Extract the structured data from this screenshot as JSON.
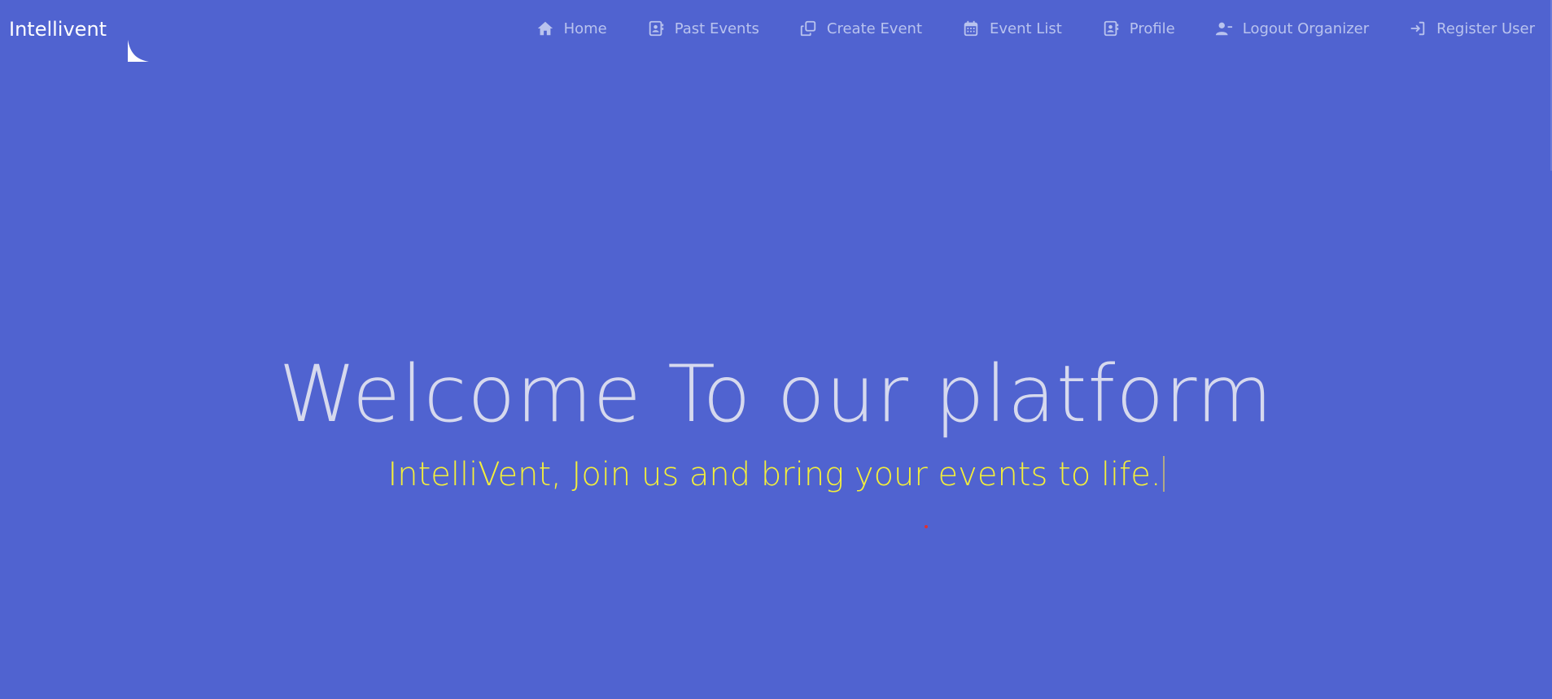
{
  "brand": {
    "name": "Intellivent"
  },
  "nav": {
    "items": [
      {
        "label": "Home",
        "icon": "home-icon"
      },
      {
        "label": "Past Events",
        "icon": "contact-card-icon"
      },
      {
        "label": "Create Event",
        "icon": "copy-icon"
      },
      {
        "label": "Event List",
        "icon": "calendar-icon"
      },
      {
        "label": "Profile",
        "icon": "contact-card-icon"
      },
      {
        "label": "Logout Organizer",
        "icon": "user-minus-icon"
      },
      {
        "label": "Register User",
        "icon": "sign-in-icon"
      }
    ]
  },
  "hero": {
    "title": "Welcome To our platform",
    "subtitle": "IntelliVent, Join us and bring your events to life."
  },
  "colors": {
    "background": "#5063d0",
    "nav_text": "#b9c3ee",
    "title": "#d6d9ee",
    "subtitle": "#f4ef3a"
  }
}
